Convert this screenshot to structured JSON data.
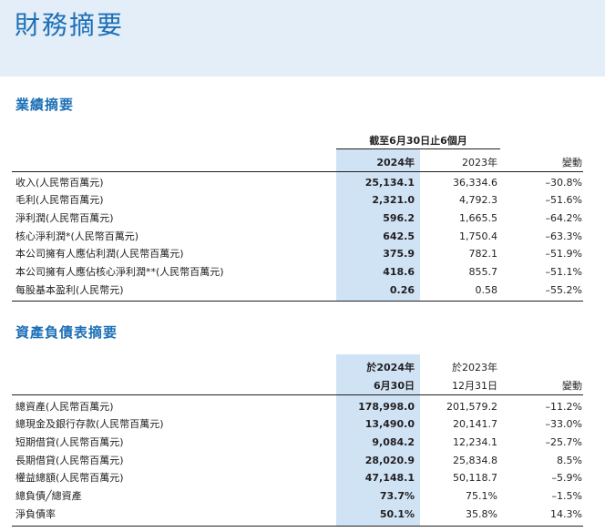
{
  "page_title": "財務摘要",
  "performance": {
    "title": "業績摘要",
    "period_header": "截至6月30日止6個月",
    "col_current": "2024年",
    "col_prior": "2023年",
    "col_change": "變動",
    "rows": [
      {
        "label": "收入(人民幣百萬元)",
        "current": "25,134.1",
        "prior": "36,334.6",
        "change": "–30.8%"
      },
      {
        "label": "毛利(人民幣百萬元)",
        "current": "2,321.0",
        "prior": "4,792.3",
        "change": "–51.6%"
      },
      {
        "label": "淨利潤(人民幣百萬元)",
        "current": "596.2",
        "prior": "1,665.5",
        "change": "–64.2%"
      },
      {
        "label": "核心淨利潤*(人民幣百萬元)",
        "current": "642.5",
        "prior": "1,750.4",
        "change": "–63.3%"
      },
      {
        "label": "本公司擁有人應佔利潤(人民幣百萬元)",
        "current": "375.9",
        "prior": "782.1",
        "change": "–51.9%"
      },
      {
        "label": "本公司擁有人應佔核心淨利潤**(人民幣百萬元)",
        "current": "418.6",
        "prior": "855.7",
        "change": "–51.1%"
      },
      {
        "label": "每股基本盈利(人民幣元)",
        "current": "0.26",
        "prior": "0.58",
        "change": "–55.2%"
      }
    ]
  },
  "balance": {
    "title": "資產負債表摘要",
    "col_current_line1": "於2024年",
    "col_current_line2": "6月30日",
    "col_prior_line1": "於2023年",
    "col_prior_line2": "12月31日",
    "col_change": "變動",
    "rows": [
      {
        "label": "總資產(人民幣百萬元)",
        "current": "178,998.0",
        "prior": "201,579.2",
        "change": "–11.2%"
      },
      {
        "label": "總現金及銀行存款(人民幣百萬元)",
        "current": "13,490.0",
        "prior": "20,141.7",
        "change": "–33.0%"
      },
      {
        "label": "短期借貸(人民幣百萬元)",
        "current": "9,084.2",
        "prior": "12,234.1",
        "change": "–25.7%"
      },
      {
        "label": "長期借貸(人民幣百萬元)",
        "current": "28,020.9",
        "prior": "25,834.8",
        "change": "8.5%"
      },
      {
        "label": "權益總額(人民幣百萬元)",
        "current": "47,148.1",
        "prior": "50,118.7",
        "change": "–5.9%"
      },
      {
        "label": "總負債╱總資產",
        "current": "73.7%",
        "prior": "75.1%",
        "change": "–1.5%"
      },
      {
        "label": "淨負債率",
        "current": "50.1%",
        "prior": "35.8%",
        "change": "14.3%"
      }
    ]
  }
}
